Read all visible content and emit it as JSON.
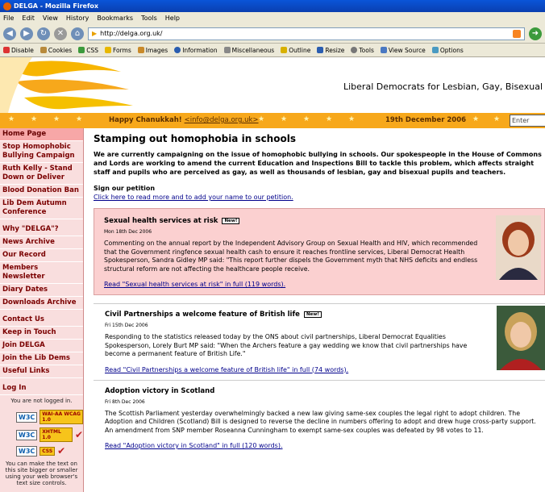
{
  "window": {
    "title": "DELGA - Mozilla Firefox"
  },
  "menu": [
    "File",
    "Edit",
    "View",
    "History",
    "Bookmarks",
    "Tools",
    "Help"
  ],
  "nav": {
    "url": "http://delga.org.uk/"
  },
  "toolbar": [
    "Disable",
    "Cookies",
    "CSS",
    "Forms",
    "Images",
    "Information",
    "Miscellaneous",
    "Outline",
    "Resize",
    "Tools",
    "View Source",
    "Options"
  ],
  "banner": {
    "tagline": "Liberal Democrats for Lesbian, Gay, Bisexual and Tran"
  },
  "starbar": {
    "greeting": "Happy Chanukkah!",
    "email": "<info@delga.org.uk>",
    "date": "19th December 2006",
    "search_placeholder": "Enter search"
  },
  "sidebar": {
    "items": [
      "Home Page",
      "Stop Homophobic Bullying Campaign",
      "Ruth Kelly - Stand Down or Deliver",
      "Blood Donation Ban",
      "Lib Dem Autumn Conference",
      "Why \"DELGA\"?",
      "News Archive",
      "Our Record",
      "Members Newsletter",
      "Diary Dates",
      "Downloads Archive",
      "Contact Us",
      "Keep in Touch",
      "Join DELGA",
      "Join the Lib Dems",
      "Useful Links",
      "Log In"
    ],
    "login_status": "You are not logged in.",
    "badges": [
      {
        "w3c": "W3C",
        "label": "WAI-AA WCAG 1.0"
      },
      {
        "w3c": "W3C",
        "label": "XHTML 1.0"
      },
      {
        "w3c": "W3C",
        "label": "CSS"
      }
    ],
    "text_note": "You can make the text on this site bigger or smaller using your web browser's text size controls."
  },
  "main": {
    "title": "Stamping out homophobia in schools",
    "intro": "We are currently campaigning on the issue of homophobic bullying in schools. Our spokespeople in the House of Commons and Lords are working to amend the current Education and Inspections Bill to tackle this problem, which affects straight staff and pupils who are perceived as gay, as well as thousands of lesbian, gay and bisexual pupils and teachers.",
    "petition_heading": "Sign our petition",
    "petition_link": "Click here to read more and to add your name to our petition.",
    "news": [
      {
        "title": "Sexual health services at risk",
        "badge": "New!",
        "date": "Mon 18th Dec 2006",
        "text": "Commenting on the annual report by the Independent Advisory Group on Sexual Health and HIV, which recommended that the Government ringfence sexual health cash to ensure it reaches frontline services, Liberal Democrat Health Spokesperson, Sandra Gidley MP said: \"This report further dispels the Government myth that NHS deficits and endless structural reform are not affecting the healthcare people receive.",
        "more": "Read \"Sexual health services at risk\" in full (119 words)."
      },
      {
        "title": "Civil Partnerships a welcome feature of British life",
        "badge": "New!",
        "date": "Fri 15th Dec 2006",
        "text": "Responding to the statistics released today by the ONS about civil partnerships, Liberal Democrat Equalities Spokesperson, Lorely Burt MP said: \"When the Archers feature a gay wedding we know that civil partnerships have become a permanent feature of British Life.\"",
        "more": "Read \"Civil Partnerships a welcome feature of British life\" in full (74 words)."
      },
      {
        "title": "Adoption victory in Scotland",
        "date": "Fri 8th Dec 2006",
        "text": "The Scottish Parliament yesterday overwhelmingly backed a new law giving same-sex couples the legal right to adopt children. The Adoption and Children (Scotland) Bill is designed to reverse the decline in numbers offering to adopt and drew huge cross-party support. An amendment from SNP member Roseanna Cunningham to exempt same-sex couples was defeated by 98 votes to 11.",
        "more": "Read \"Adoption victory in Scotland\" in full (120 words)."
      }
    ]
  }
}
